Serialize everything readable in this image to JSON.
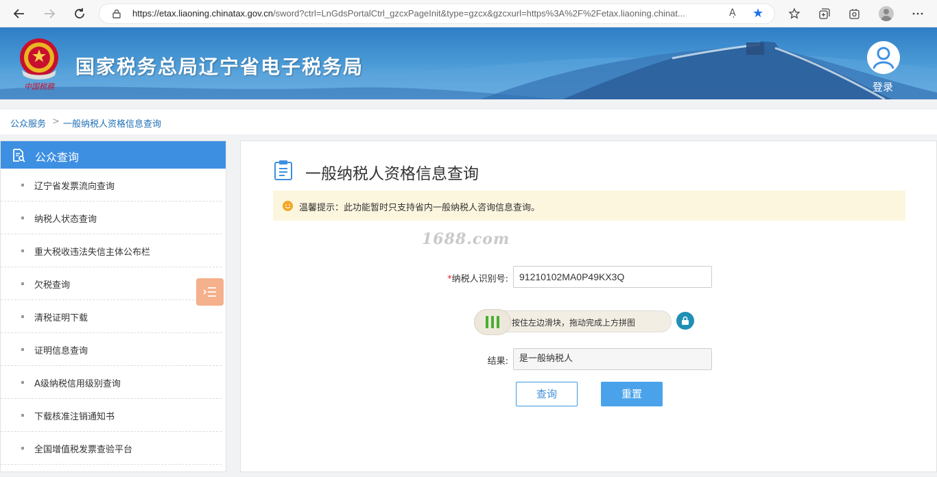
{
  "browser": {
    "url_host": "https://etax.liaoning.chinatax.gov.cn",
    "url_rest": "/sword?ctrl=LnGdsPortalCtrl_gzcxPageInit&type=gzcx&gzcxurl=https%3A%2F%2Fetax.liaoning.chinat...",
    "read_aloud": "Aͅ",
    "icons": [
      "back-icon",
      "forward-icon",
      "refresh-icon",
      "lock-icon",
      "read-aloud-icon",
      "favorite-star-icon",
      "favorites-icon",
      "collections-icon",
      "extensions-icon",
      "profile-icon",
      "more-icon"
    ]
  },
  "banner": {
    "title": "国家税务总局辽宁省电子税务局",
    "login_label": "登录"
  },
  "breadcrumb": {
    "home": "公众服务",
    "separator": ">",
    "current": "一般纳税人资格信息查询"
  },
  "sidebar": {
    "title": "公众查询",
    "items": [
      {
        "label": "辽宁省发票流向查询"
      },
      {
        "label": "纳税人状态查询"
      },
      {
        "label": "重大税收违法失信主体公布栏"
      },
      {
        "label": "欠税查询"
      },
      {
        "label": "清税证明下载"
      },
      {
        "label": "证明信息查询"
      },
      {
        "label": "A级纳税信用级别查询"
      },
      {
        "label": "下载核准注销通知书"
      },
      {
        "label": "全国增值税发票查验平台"
      }
    ]
  },
  "main": {
    "title": "一般纳税人资格信息查询",
    "notice": "温馨提示：此功能暂时只支持省内一般纳税人咨询信息查询。",
    "watermark": "1688.com",
    "taxpayer_id": {
      "required_mark": "*",
      "label": "纳税人识别号:",
      "value": "91210102MA0P49KX3Q"
    },
    "slider_text": "按住左边滑块，拖动完成上方拼图",
    "result": {
      "label": "结果:",
      "value": "是一般纳税人"
    },
    "query_button": "查询",
    "reset_button": "重置"
  },
  "colors": {
    "accent": "#3d8fe2",
    "notice_bg": "#fdf6df",
    "float_button": "#f5b08c",
    "slider_bar": "#49b02d"
  }
}
